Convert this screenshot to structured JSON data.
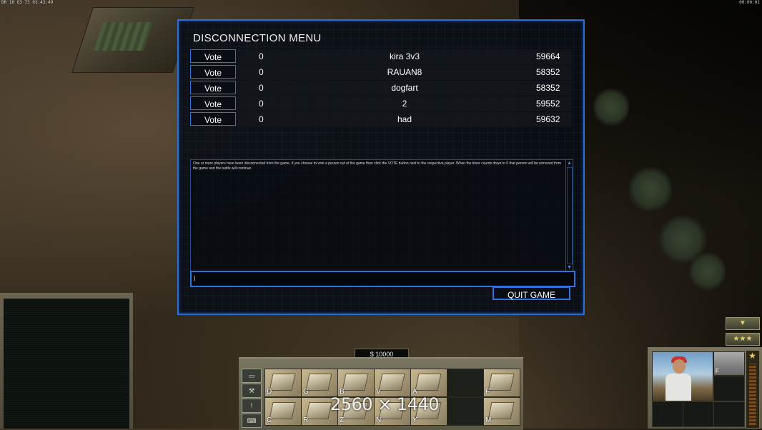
{
  "hud": {
    "top_left": "DR 10 63 73 01:43:49",
    "top_right": "00:00:01",
    "money": "$ 10000",
    "resolution_watermark": "2560 × 1440"
  },
  "dialog": {
    "title": "DISCONNECTION MENU",
    "vote_label": "Vote",
    "players": [
      {
        "votes": "0",
        "name": "kira 3v3",
        "ping": "59664"
      },
      {
        "votes": "0",
        "name": "RAUAN8",
        "ping": "58352"
      },
      {
        "votes": "0",
        "name": "dogfart",
        "ping": "58352"
      },
      {
        "votes": "0",
        "name": "2",
        "ping": "59552"
      },
      {
        "votes": "0",
        "name": "had",
        "ping": "59632"
      }
    ],
    "message": "One or more players have been disconnected from the game. If you choose to vote a person out of the game then click the VOTE button next to the respective player. When the timer counts down to 0 that person will be removed from the game and the battle will continue.",
    "chat_value": "|",
    "quit_label": "QUIT GAME"
  },
  "command_bar": {
    "tabs": [
      "▭",
      "⚒",
      "!",
      "⌨"
    ],
    "buttons": [
      {
        "key": "D"
      },
      {
        "key": "G"
      },
      {
        "key": "B"
      },
      {
        "key": "V"
      },
      {
        "key": "A"
      },
      {
        "key": ""
      },
      {
        "key": "F"
      },
      {
        "key": "C"
      },
      {
        "key": "R"
      },
      {
        "key": "Z"
      },
      {
        "key": "N"
      },
      {
        "key": "Y"
      },
      {
        "key": ""
      },
      {
        "key": "M"
      }
    ]
  },
  "unit_panel": {
    "ability_key": "F",
    "rank_stars": "★★★",
    "arrow": "▼",
    "rank_star": "★"
  },
  "colors": {
    "accent": "#2d74e0",
    "panel": "#0a0e16"
  }
}
